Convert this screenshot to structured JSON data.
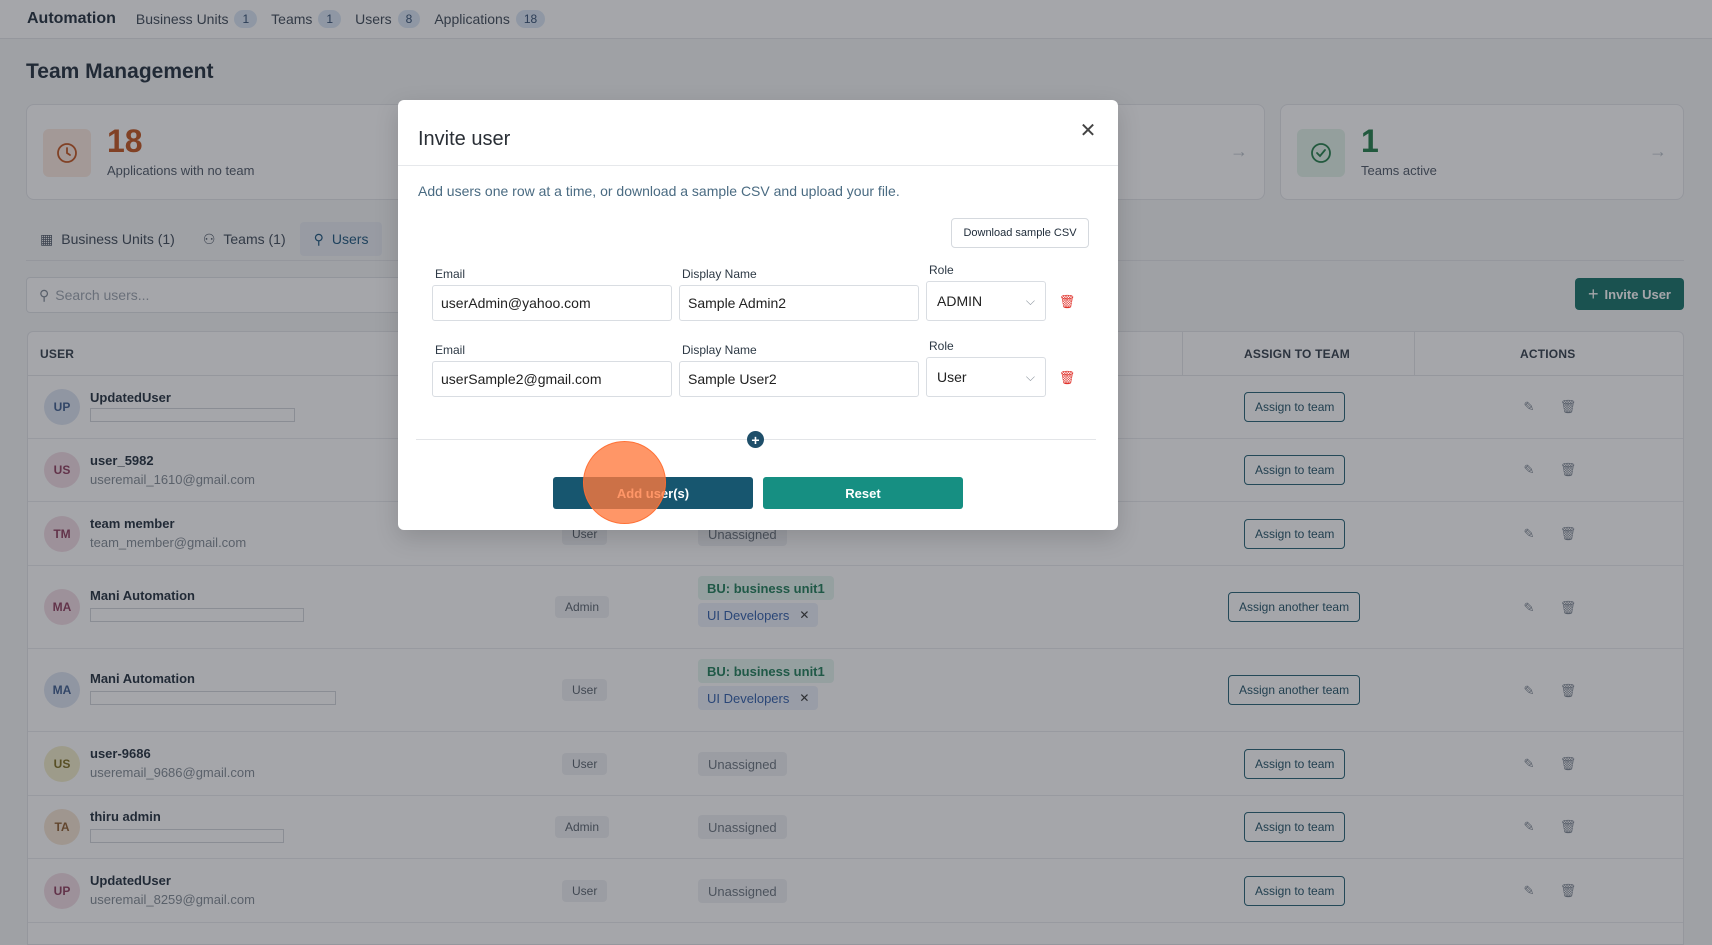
{
  "topnav": {
    "brand": "Automation",
    "items": [
      {
        "label": "Business Units",
        "count": "1"
      },
      {
        "label": "Teams",
        "count": "1"
      },
      {
        "label": "Users",
        "count": "8"
      },
      {
        "label": "Applications",
        "count": "18"
      }
    ]
  },
  "page": {
    "title": "Team Management"
  },
  "stats": [
    {
      "value": "18",
      "label": "Applications with no team",
      "color": "#c2521b",
      "icon": "clock-icon"
    },
    {
      "value": "1",
      "label": "Teams active",
      "color": "#1e7a45",
      "icon": "check-circle-icon"
    }
  ],
  "tabs": [
    {
      "label": "Business Units (1)",
      "icon": "building-icon"
    },
    {
      "label": "Teams (1)",
      "icon": "users-icon"
    },
    {
      "label": "Users",
      "icon": "user-icon"
    }
  ],
  "search": {
    "placeholder": "Search users..."
  },
  "invite_button": {
    "label": "Invite User"
  },
  "table": {
    "headers": {
      "user": "USER",
      "assign": "ASSIGN TO TEAM",
      "actions": "ACTIONS"
    },
    "rows": [
      {
        "initials": "UP",
        "name": "UpdatedUser",
        "email": "",
        "role": "",
        "team": "",
        "bu": "",
        "dev": "",
        "assign": "Assign to team"
      },
      {
        "initials": "US",
        "name": "user_5982",
        "email": "useremail_1610@gmail.com",
        "role": "",
        "team": "",
        "bu": "",
        "dev": "",
        "assign": "Assign to team"
      },
      {
        "initials": "TM",
        "name": "team member",
        "email": "team_member@gmail.com",
        "role": "User",
        "team": "Unassigned",
        "bu": "",
        "dev": "",
        "assign": "Assign to team"
      },
      {
        "initials": "MA",
        "name": "Mani Automation",
        "email": "",
        "role": "Admin",
        "team": "",
        "bu": "BU: business unit1",
        "dev": "UI Developers",
        "assign": "Assign another team"
      },
      {
        "initials": "MA",
        "name": "Mani Automation",
        "email": "",
        "role": "User",
        "team": "",
        "bu": "BU: business unit1",
        "dev": "UI Developers",
        "assign": "Assign another team"
      },
      {
        "initials": "US",
        "name": "user-9686",
        "email": "useremail_9686@gmail.com",
        "role": "User",
        "team": "Unassigned",
        "bu": "",
        "dev": "",
        "assign": "Assign to team"
      },
      {
        "initials": "TA",
        "name": "thiru admin",
        "email": "",
        "role": "Admin",
        "team": "Unassigned",
        "bu": "",
        "dev": "",
        "assign": "Assign to team"
      },
      {
        "initials": "UP",
        "name": "UpdatedUser",
        "email": "useremail_8259@gmail.com",
        "role": "User",
        "team": "Unassigned",
        "bu": "",
        "dev": "",
        "assign": "Assign to team"
      }
    ]
  },
  "modal": {
    "title": "Invite user",
    "description": "Add users one row at a time, or download a sample CSV and upload your file.",
    "download_label": "Download sample CSV",
    "labels": {
      "email": "Email",
      "display_name": "Display Name",
      "role": "Role"
    },
    "rows": [
      {
        "email": "userAdmin@yahoo.com",
        "display_name": "Sample Admin2",
        "role": "ADMIN"
      },
      {
        "email": "userSample2@gmail.com",
        "display_name": "Sample User2",
        "role": "User"
      }
    ],
    "add_label": "Add user(s)",
    "reset_label": "Reset"
  }
}
